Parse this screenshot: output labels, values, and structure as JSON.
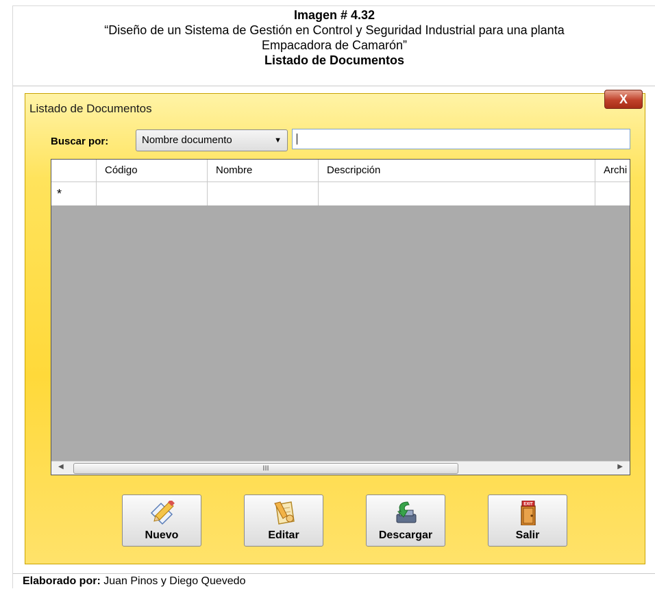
{
  "caption": {
    "line1": "Imagen # 4.32",
    "line2": "“Diseño de un Sistema de Gestión en Control y Seguridad Industrial para una planta",
    "line3": "Empacadora de Camarón”",
    "line4": "Listado de Documentos"
  },
  "window": {
    "title": "Listado de Documentos",
    "close_label": "X"
  },
  "search": {
    "label": "Buscar por:",
    "select_value": "Nombre documento",
    "input_value": ""
  },
  "grid": {
    "columns": [
      "Código",
      "Nombre",
      "Descripción",
      "Archi"
    ],
    "new_row_marker": "*",
    "scroll_thumb": "III"
  },
  "buttons": {
    "nuevo": "Nuevo",
    "editar": "Editar",
    "descargar": "Descargar",
    "salir": "Salir",
    "exit_sign": "EXIT"
  },
  "footer": {
    "label": "Elaborado por:",
    "authors": "Juan Pinos y Diego Quevedo"
  },
  "icons": {
    "new": "pencil-document-icon",
    "edit": "edit-paper-icon",
    "download": "download-printer-icon",
    "exit": "exit-door-icon"
  }
}
